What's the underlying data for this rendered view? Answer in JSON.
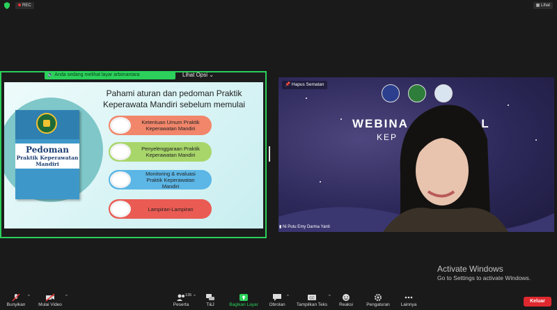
{
  "topbar": {
    "rec_label": "REC",
    "view_label": "Lihat"
  },
  "share": {
    "banner_text": "Anda sedang melihat layar arbimantara",
    "view_options": "Lihat Opsi"
  },
  "slide": {
    "heading_line1": "Pahami aturan dan pedoman Praktik",
    "heading_line2": "Keperawata Mandiri sebelum memulai",
    "book_title": "Pedoman",
    "book_subtitle_line1": "Praktik Keperawatan",
    "book_subtitle_line2": "Mandiri",
    "items": [
      {
        "line1": "Ketentuan Umum Praktik",
        "line2": "Keperawatan Mandiri"
      },
      {
        "line1": "Penyelenggaraan Praktik",
        "line2": "Keperawatan Mandiri"
      },
      {
        "line1": "Monitoring & evaluasi",
        "line2": "Praktik Keperawatan",
        "line3": "Mandiri"
      },
      {
        "line1": "Lampiran-Lampiran"
      }
    ]
  },
  "video": {
    "unpin_label": "Hapus Sematan",
    "banner_word1": "WEBINA",
    "banner_word2": "AL",
    "banner_word3": "KEP",
    "participant_name": "Ni Putu Emy Darma Yanti"
  },
  "watermark": {
    "title": "Activate Windows",
    "subtitle": "Go to Settings to activate Windows."
  },
  "toolbar": {
    "unmute": "Bunyikan",
    "start_video": "Mulai Video",
    "participants": "Peserta",
    "participant_count": "135",
    "qa": "T&J",
    "share_screen": "Bagikan Layar",
    "chat": "Obrolan",
    "show_captions": "Tampilkan Teks",
    "reactions": "Reaksi",
    "settings": "Pengaturan",
    "more": "Lainnya",
    "leave": "Keluar"
  },
  "colors": {
    "share_green": "#2bd15b",
    "leave_red": "#e0282f"
  }
}
